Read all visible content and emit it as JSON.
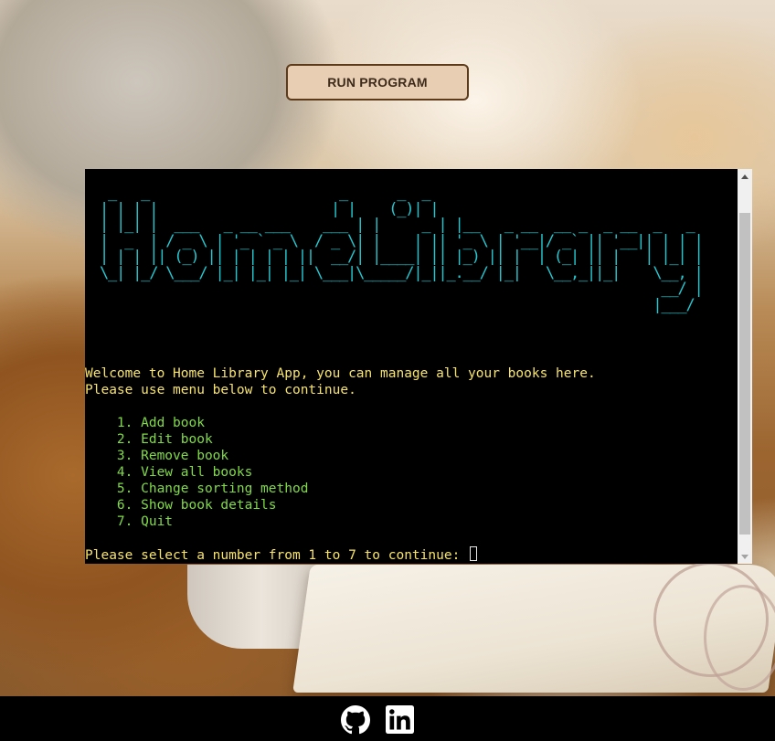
{
  "header": {
    "run_button_label": "RUN PROGRAM"
  },
  "terminal": {
    "ascii_title_lines": [
      " _   _                       _      _  _                               ",
      "| | | |                     | |    (_)| |                              ",
      "| |_| |  ___   _ __ ___    ___ | |     _ | |__   _ __  __ _  _ __  _   _ ",
      "|  _  | / _ \\ | '_ ` _ \\  / _ \\| |    | || '_ \\ | '__|/ _` || '__|| | | |",
      "| | | || (_) || | | | | ||  __/| |____| || |_) || |  | (_| || |   | |_| |",
      "\\_| |_/ \\___/ |_| |_| |_| \\___|\\_____/|_||_.__/ |_|   \\__,_||_|    \\__, |",
      "                                                                    __/ |",
      "                                                                   |___/ "
    ],
    "welcome_line_1": "Welcome to Home Library App, you can manage all your books here.",
    "welcome_line_2": "Please use menu below to continue.",
    "menu_items": [
      "    1. Add book",
      "    2. Edit book",
      "    3. Remove book",
      "    4. View all books",
      "    5. Change sorting method",
      "    6. Show book details",
      "    7. Quit"
    ],
    "prompt": "Please select a number from 1 to 7 to continue: "
  },
  "footer": {
    "icons": [
      "github-icon",
      "linkedin-icon"
    ]
  },
  "colors": {
    "ascii_art": "#25c6cf",
    "prompt_text": "#f7e36a",
    "menu_text": "#7fdc45",
    "button_bg": "#e8cfb4",
    "button_border": "#5c3a1a"
  }
}
